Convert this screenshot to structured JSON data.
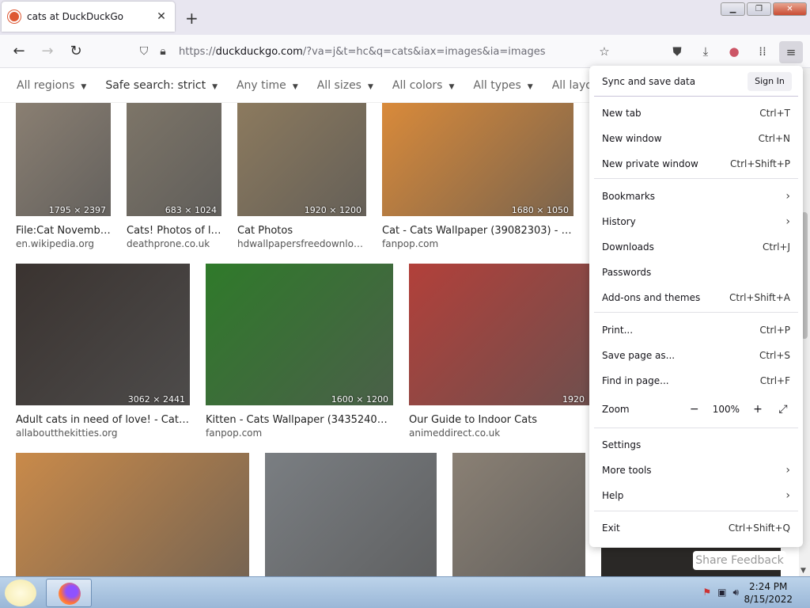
{
  "browser": {
    "tab_title": "cats at DuckDuckGo",
    "url_prefix": "https://",
    "url_domain": "duckduckgo.com",
    "url_rest": "/?va=j&t=hc&q=cats&iax=images&ia=images"
  },
  "filters": [
    {
      "label": "All regions"
    },
    {
      "label": "Safe search: strict"
    },
    {
      "label": "Any time"
    },
    {
      "label": "All sizes"
    },
    {
      "label": "All colors"
    },
    {
      "label": "All types"
    },
    {
      "label": "All layouts"
    }
  ],
  "results": [
    {
      "title": "File:Cat November...",
      "source": "en.wikipedia.org",
      "dims": "1795 × 2397",
      "color": "#8a7f72"
    },
    {
      "title": "Cats! Photos of lot...",
      "source": "deathprone.co.uk",
      "dims": "683 × 1024",
      "color": "#7d7568"
    },
    {
      "title": "Cat Photos",
      "source": "hdwallpapersfreedownload....",
      "dims": "1920 × 1200",
      "color": "#8c7a5e"
    },
    {
      "title": "Cat - Cats Wallpaper (39082303) - Fan...",
      "source": "fanpop.com",
      "dims": "1680 × 1050",
      "color": "#d98a3a"
    },
    {
      "title": "Adult cats in need of love! - Cat & Ki...",
      "source": "allaboutthekitties.org",
      "dims": "3062 × 2441",
      "color": "#3a3330"
    },
    {
      "title": "Kitten - Cats Wallpaper (34352405) - F...",
      "source": "fanpop.com",
      "dims": "1600 × 1200",
      "color": "#2f7a2a"
    },
    {
      "title": "Our Guide to Indoor Cats",
      "source": "animeddirect.co.uk",
      "dims": "1920",
      "color": "#b2403a"
    },
    {
      "title": "",
      "source": "",
      "dims": "",
      "color": "#c98a4a"
    },
    {
      "title": "",
      "source": "",
      "dims": "",
      "color": "#7a7e82"
    },
    {
      "title": "",
      "source": "",
      "dims": "",
      "color": "#8a8074"
    }
  ],
  "menu": {
    "sync_label": "Sync and save data",
    "signin_label": "Sign In",
    "new_tab": {
      "label": "New tab",
      "shortcut": "Ctrl+T"
    },
    "new_window": {
      "label": "New window",
      "shortcut": "Ctrl+N"
    },
    "new_private": {
      "label": "New private window",
      "shortcut": "Ctrl+Shift+P"
    },
    "bookmarks": {
      "label": "Bookmarks"
    },
    "history": {
      "label": "History"
    },
    "downloads": {
      "label": "Downloads",
      "shortcut": "Ctrl+J"
    },
    "passwords": {
      "label": "Passwords"
    },
    "addons": {
      "label": "Add-ons and themes",
      "shortcut": "Ctrl+Shift+A"
    },
    "print": {
      "label": "Print...",
      "shortcut": "Ctrl+P"
    },
    "save_page": {
      "label": "Save page as...",
      "shortcut": "Ctrl+S"
    },
    "find": {
      "label": "Find in page...",
      "shortcut": "Ctrl+F"
    },
    "zoom": {
      "label": "Zoom",
      "value": "100%",
      "minus": "−",
      "plus": "+"
    },
    "settings": {
      "label": "Settings"
    },
    "more_tools": {
      "label": "More tools"
    },
    "help": {
      "label": "Help"
    },
    "exit": {
      "label": "Exit",
      "shortcut": "Ctrl+Shift+Q"
    }
  },
  "feedback_label": "Share Feedback",
  "taskbar": {
    "time": "2:24 PM",
    "date": "8/15/2022"
  }
}
